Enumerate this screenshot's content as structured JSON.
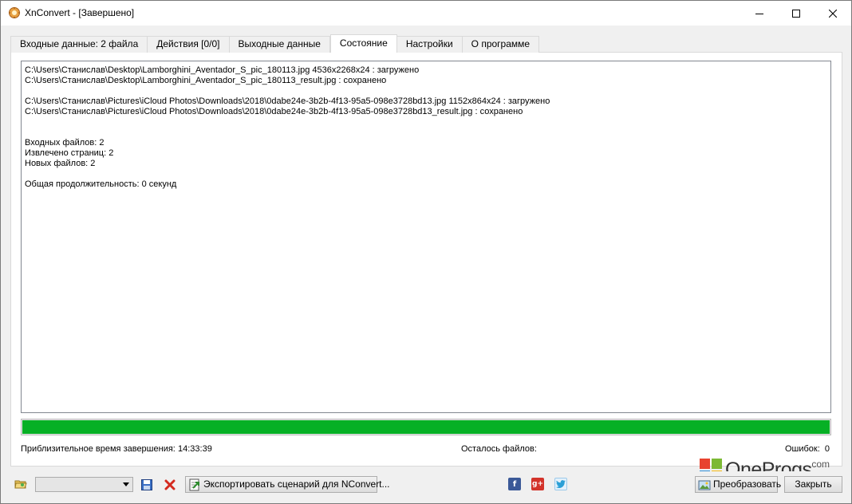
{
  "window": {
    "title": "XnConvert - [Завершено]"
  },
  "tabs": [
    {
      "label": "Входные данные: 2 файла",
      "active": false
    },
    {
      "label": "Действия [0/0]",
      "active": false
    },
    {
      "label": "Выходные данные",
      "active": false
    },
    {
      "label": "Состояние",
      "active": true
    },
    {
      "label": "Настройки",
      "active": false
    },
    {
      "label": "О программе",
      "active": false
    }
  ],
  "log": {
    "lines": [
      "C:\\Users\\Станислав\\Desktop\\Lamborghini_Aventador_S_pic_180113.jpg 4536x2268x24 : загружено",
      "C:\\Users\\Станислав\\Desktop\\Lamborghini_Aventador_S_pic_180113_result.jpg : сохранено",
      "",
      "C:\\Users\\Станислав\\Pictures\\iCloud Photos\\Downloads\\2018\\0dabe24e-3b2b-4f13-95a5-098e3728bd13.jpg 1152x864x24 : загружено",
      "C:\\Users\\Станислав\\Pictures\\iCloud Photos\\Downloads\\2018\\0dabe24e-3b2b-4f13-95a5-098e3728bd13_result.jpg : сохранено",
      "",
      "",
      "Входных файлов: 2",
      "Извлечено страниц: 2",
      "Новых файлов: 2",
      "",
      "Общая продолжительность: 0 секунд"
    ]
  },
  "progress": {
    "fraction": 1.0,
    "color": "#06b025"
  },
  "status": {
    "eta_label": "Приблизительное время завершения:",
    "eta_value": "14:33:39",
    "remaining_label": "Осталось файлов:",
    "errors_label": "Ошибок:",
    "errors_value": "0"
  },
  "toolbar": {
    "export_label": "Экспортировать сценарий для NConvert...",
    "convert_label": "Преобразовать",
    "close_label": "Закрыть",
    "preset_value": ""
  },
  "social": {
    "facebook": "f",
    "google": "g+",
    "twitter": "t"
  },
  "watermark": {
    "brand": "OneProgs",
    "tld": ".com"
  }
}
